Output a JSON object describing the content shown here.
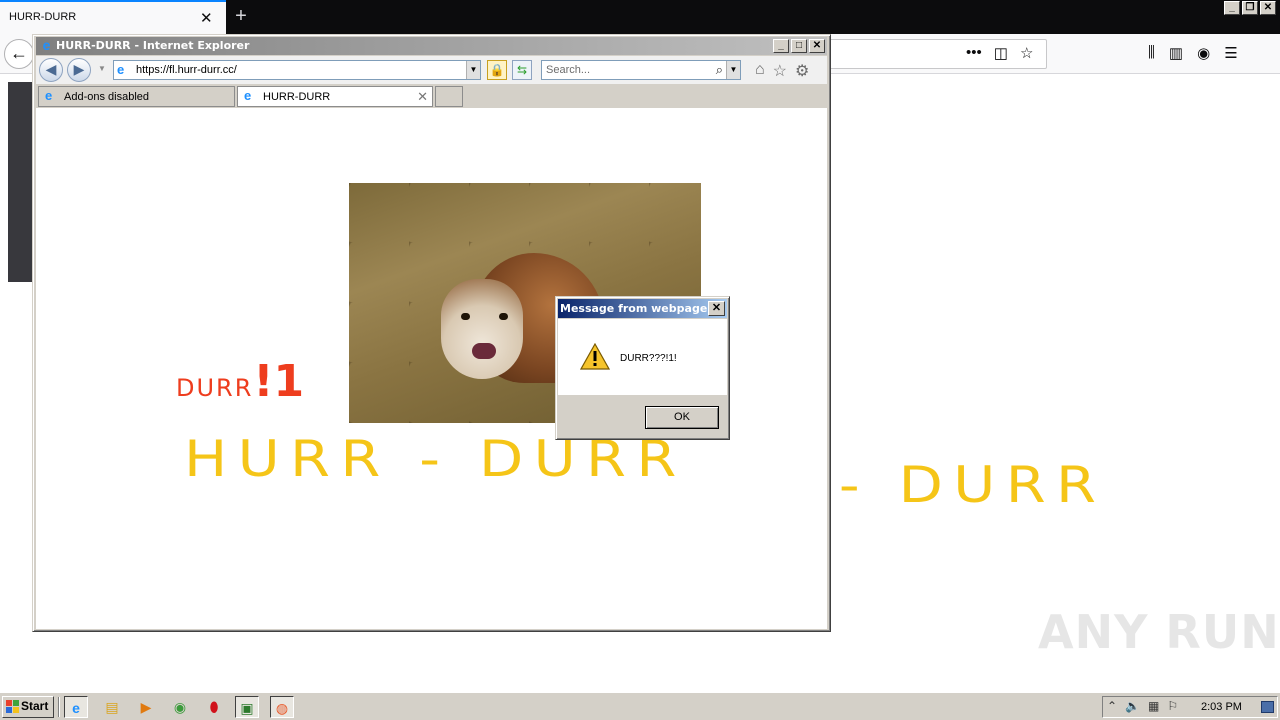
{
  "firefox": {
    "tab_title": "HURR-DURR",
    "tab_close": "✕",
    "new_tab": "+",
    "back_icon": "←",
    "page_actions": [
      "•••",
      "◫",
      "☆"
    ],
    "toolbar_icons": [
      "⫼",
      "▥",
      "◉",
      "☰"
    ],
    "caption": {
      "minimize": "_",
      "restore": "❐",
      "close": "✕"
    }
  },
  "ie": {
    "window_title": "HURR-DURR - Internet Explorer",
    "caption": {
      "minimize": "_",
      "maximize": "□",
      "close": "✕"
    },
    "address": "https://fl.hurr-durr.cc/",
    "search_placeholder": "Search...",
    "tabs": [
      {
        "label": "Add-ons disabled"
      },
      {
        "label": "HURR-DURR",
        "close": "✕"
      }
    ]
  },
  "page": {
    "durr_text": "DURR",
    "durr_exclaim": "!1",
    "hurr_durr": "HURR - DURR",
    "hurr_durr_bg": "R - DURR"
  },
  "dialog": {
    "title": "Message from webpage",
    "message": "DURR???!1!",
    "ok_label": "OK",
    "close": "✕"
  },
  "taskbar": {
    "start_label": "Start",
    "clock": "2:03 PM",
    "apps": [
      "ie-icon",
      "explorer-icon",
      "media-player-icon",
      "chrome-icon",
      "opera-icon",
      "terminal-icon",
      "firefox-icon"
    ]
  },
  "watermark": "ANY RUN",
  "colors": {
    "hurr_yellow": "#f5c518",
    "durr_red": "#ee3d1e",
    "dialog_title_blue": "#0a246a"
  }
}
